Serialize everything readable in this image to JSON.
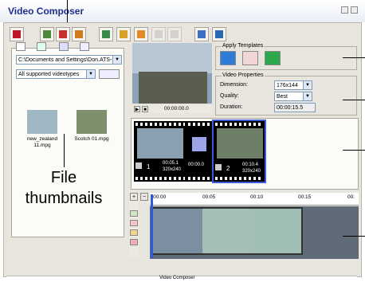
{
  "window": {
    "title": "Video Composer"
  },
  "browser": {
    "path": "C:\\Documents and Settings\\Don.ATS-D",
    "filter": "All supported videotypes",
    "files": [
      {
        "name": "new_zealand\n11.mpg"
      },
      {
        "name": "Scotch 01.mpg"
      }
    ]
  },
  "preview": {
    "timecode": "00:00:00.0"
  },
  "templates": {
    "title": "Apply Templates"
  },
  "properties": {
    "title": "Video Properties",
    "dimension_label": "Dimension:",
    "dimension_value": "176x144",
    "quality_label": "Quality:",
    "quality_value": "Best",
    "duration_label": "Duration:",
    "duration_value": "00:00:15.5"
  },
  "clips": [
    {
      "index": "1",
      "time": "00:05.1",
      "res": "320x240",
      "trans": "00:00.0"
    },
    {
      "index": "2",
      "time": "00:10.4",
      "res": "320x240"
    }
  ],
  "timeline": {
    "ticks": [
      "00:00",
      "00:05",
      "00:10",
      "00:15",
      "00:"
    ]
  },
  "annotation": {
    "label": "File\nthumbnails"
  },
  "taskbar": {
    "label": "Video Composer"
  }
}
